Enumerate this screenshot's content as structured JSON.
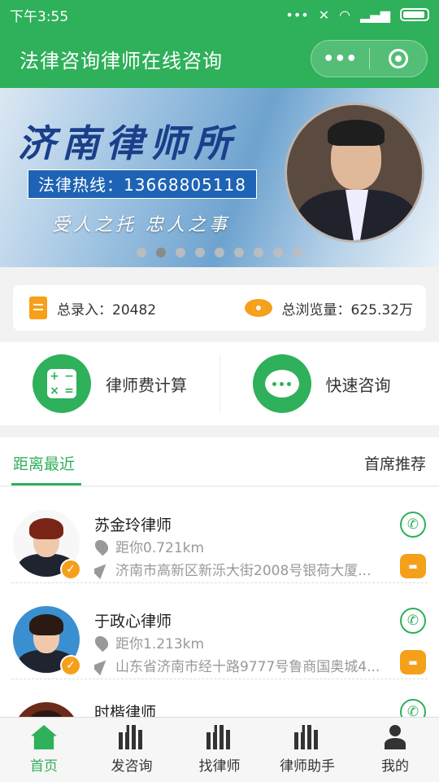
{
  "status": {
    "time": "下午3:55"
  },
  "header": {
    "title": "法律咨询律师在线咨询",
    "more_label": "•••"
  },
  "banner": {
    "title": "济南律师所",
    "hotline": "法律热线：13668805118",
    "slogan": "受人之托 忠人之事",
    "slide_count": 9,
    "active_slide": 2
  },
  "stats": {
    "entries_label": "总录入：20482",
    "views_label": "总浏览量：625.32万"
  },
  "actions": {
    "fee_calc": "律师费计算",
    "quick_consult": "快速咨询"
  },
  "tabs": {
    "nearest": "距离最近",
    "featured": "首席推荐"
  },
  "lawyers": [
    {
      "name": "苏金玲律师",
      "distance": "距你0.721km",
      "address": "济南市高新区新泺大街2008号银荷大厦..."
    },
    {
      "name": "于政心律师",
      "distance": "距你1.213km",
      "address": "山东省济南市经十路9777号鲁商国奥城4..."
    },
    {
      "name": "时楷律师",
      "distance": "",
      "address": ""
    }
  ],
  "tabbar": [
    {
      "label": "首页",
      "icon": "home-icon"
    },
    {
      "label": "发咨询",
      "icon": "post-consult-icon"
    },
    {
      "label": "找律师",
      "icon": "find-lawyer-icon"
    },
    {
      "label": "律师助手",
      "icon": "assistant-icon"
    },
    {
      "label": "我的",
      "icon": "user-icon"
    }
  ],
  "colors": {
    "brand": "#2fb05a",
    "accent": "#f5a01a"
  }
}
